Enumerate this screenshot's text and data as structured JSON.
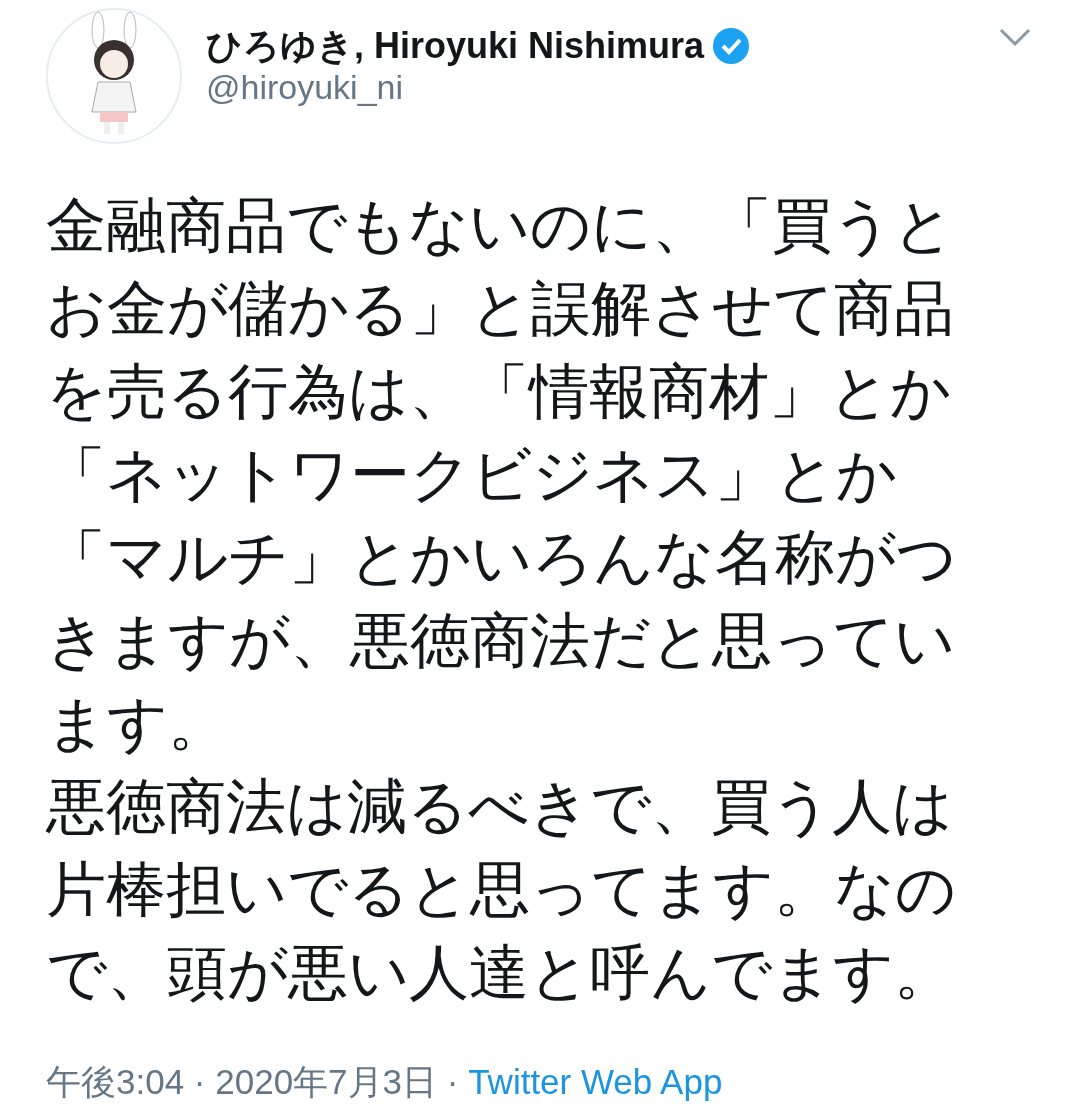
{
  "author": {
    "name": "ひろゆき, Hiroyuki Nishimura",
    "verified": true,
    "handle": "@hiroyuki_ni"
  },
  "tweet": {
    "paragraphs": [
      [
        "金融商品でもないのに、「買うと",
        "お金が儲かる」と誤解させて商品",
        "を売る行為は、「情報商材」とか",
        "「ネットワークビジネス」とか",
        "「マルチ」とかいろんな名称がつ",
        "きますが、悪徳商法だと思ってい",
        "ます。"
      ],
      [
        "悪徳商法は減るべきで、買う人は",
        "片棒担いでると思ってます。なの",
        "で、頭が悪い人達と呼んでます。"
      ]
    ]
  },
  "meta": {
    "time": "午後3:04",
    "separators": [
      "·",
      "·"
    ],
    "date": "2020年7月3日",
    "source": "Twitter Web App"
  }
}
